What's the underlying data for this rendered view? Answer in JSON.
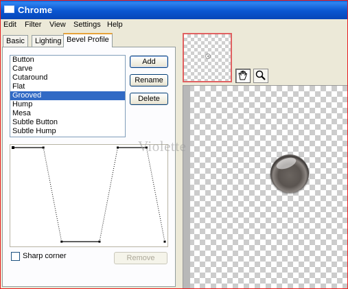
{
  "window": {
    "title": "Chrome"
  },
  "menu": {
    "items": [
      "Edit",
      "Filter",
      "View",
      "Settings",
      "Help"
    ]
  },
  "tabs": {
    "basic": "Basic",
    "lighting": "Lighting",
    "bevel_profile": "Bevel Profile",
    "active": "Bevel Profile"
  },
  "profile_list": {
    "items": [
      "Button",
      "Carve",
      "Cutaround",
      "Flat",
      "Grooved",
      "Hump",
      "Mesa",
      "Subtle Button",
      "Subtle Hump"
    ],
    "selected": "Grooved"
  },
  "buttons": {
    "add": "Add",
    "rename": "Rename",
    "delete": "Delete",
    "remove": "Remove"
  },
  "options": {
    "sharp_corner_label": "Sharp corner",
    "sharp_corner_checked": false
  },
  "profile_curve": {
    "points": [
      [
        0,
        1
      ],
      [
        0.2,
        1
      ],
      [
        0.32,
        0
      ],
      [
        0.57,
        0
      ],
      [
        0.69,
        1
      ],
      [
        0.88,
        1
      ],
      [
        1,
        0
      ]
    ]
  },
  "watermark": {
    "text": "Violette"
  },
  "tools": {
    "pan": "hand-icon",
    "zoom": "magnifier-icon",
    "active": "pan"
  },
  "colors": {
    "titlebar": "#0a56d1",
    "selection": "#316ac5",
    "window_border": "#e81c1c",
    "thumb_border": "#e06060"
  }
}
